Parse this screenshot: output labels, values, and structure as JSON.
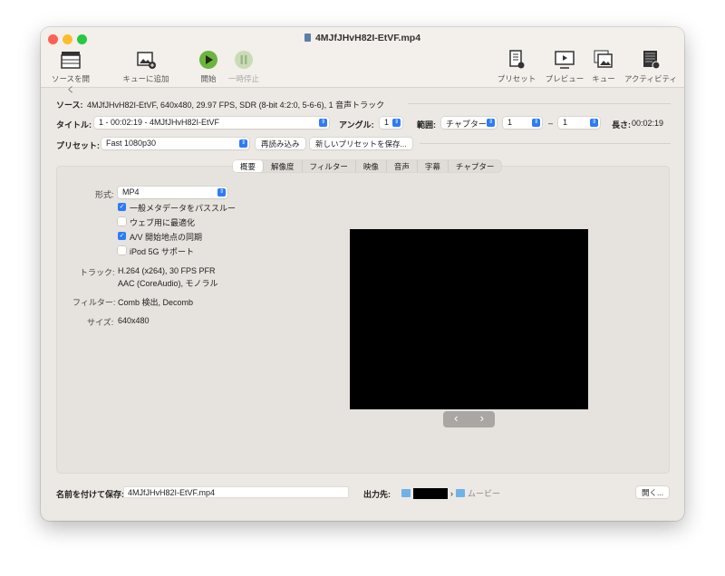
{
  "window": {
    "title": "4MJfJHvH82I-EtVF.mp4"
  },
  "toolbar": {
    "open_source": "ソースを開く",
    "add_queue": "キューに追加",
    "start": "開始",
    "pause": "一時停止",
    "presets": "プリセット",
    "preview": "プレビュー",
    "queue": "キュー",
    "activity": "アクティビティ"
  },
  "source": {
    "label": "ソース:",
    "value": "4MJfJHvH82I-EtVF, 640x480, 29.97 FPS, SDR (8-bit 4:2:0, 5-6-6), 1 音声トラック"
  },
  "title_row": {
    "label": "タイトル:",
    "value": "1 - 00:02:19 - 4MJfJHvH82I-EtVF",
    "angle_label": "アングル:",
    "angle": "1",
    "range_label": "範囲:",
    "range_type": "チャプター",
    "range_start": "1",
    "range_dash": "–",
    "range_end": "1",
    "duration_label": "長さ:",
    "duration": "00:02:19"
  },
  "preset_row": {
    "label": "プリセット:",
    "value": "Fast 1080p30",
    "reload": "再読み込み",
    "save_new": "新しいプリセットを保存..."
  },
  "tabs": [
    "概要",
    "解像度",
    "フィルター",
    "映像",
    "音声",
    "字幕",
    "チャプター"
  ],
  "summary": {
    "format_label": "形式:",
    "format": "MP4",
    "options": [
      {
        "label": "一般メタデータをパススルー",
        "checked": true
      },
      {
        "label": "ウェブ用に最適化",
        "checked": false
      },
      {
        "label": "A/V 開始地点の同期",
        "checked": true
      },
      {
        "label": "iPod 5G サポート",
        "checked": false
      }
    ],
    "tracks_label": "トラック:",
    "track1": "H.264 (x264), 30 FPS PFR",
    "track2": "AAC (CoreAudio), モノラル",
    "filters_label": "フィルター:",
    "filters": "Comb 検出, Decomb",
    "size_label": "サイズ:",
    "size": "640x480"
  },
  "preview_nav": {
    "prev": "‹",
    "next": "›"
  },
  "footer": {
    "save_as_label": "名前を付けて保存:",
    "filename": "4MJfJHvH82I-EtVF.mp4",
    "dest_label": "出力先:",
    "dest_folder": "ムービー",
    "sep": "›",
    "browse": "開く..."
  }
}
